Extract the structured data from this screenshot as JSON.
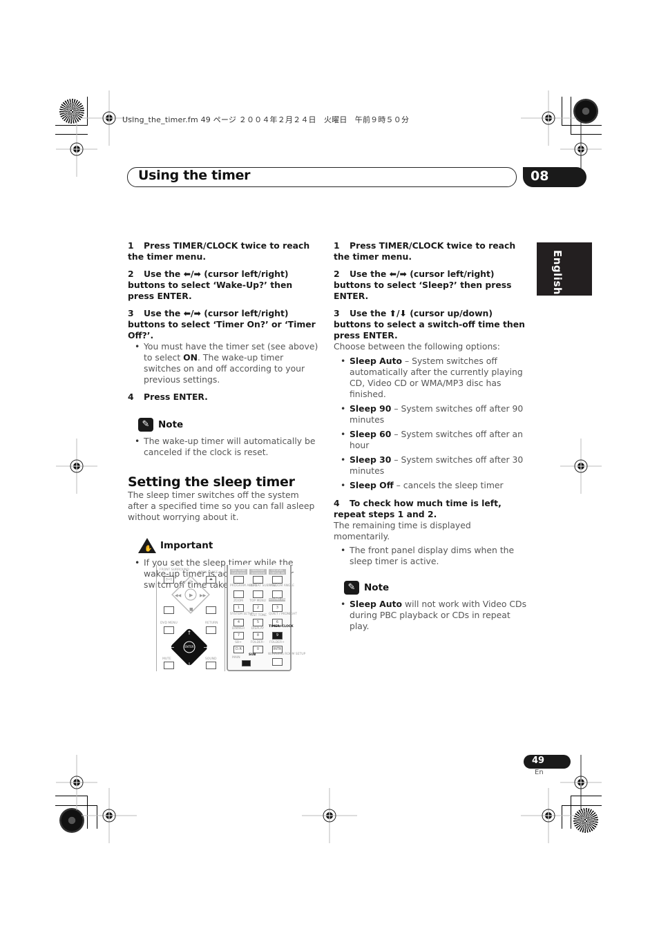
{
  "print_slug": "Using_the_timer.fm  49 ページ  ２００４年２月２４日　火曜日　午前９時５０分",
  "header": {
    "title": "Using the timer",
    "chapter": "08"
  },
  "language_tab": "English",
  "left_column": {
    "steps": [
      {
        "num": "1",
        "text": "Press TIMER/CLOCK twice to reach the timer menu."
      },
      {
        "num": "2",
        "text": "Use the ⬅/➡ (cursor left/right) buttons to select ‘Wake-Up?’ then press ENTER."
      },
      {
        "num": "3",
        "text": "Use the ⬅/➡ (cursor left/right) buttons to select ‘Timer On?’ or ‘Timer Off?’."
      }
    ],
    "step3_bullet_pre": "You must have the timer set (see above) to select ",
    "step3_bullet_bold": "ON",
    "step3_bullet_post": ". The wake-up timer switches on and off according to your previous settings.",
    "step4": {
      "num": "4",
      "text": "Press ENTER."
    },
    "note": {
      "label": "Note",
      "bullet": "The wake-up timer will automatically be canceled if the clock is reset."
    },
    "section": {
      "title": "Setting the sleep timer",
      "body": "The sleep timer switches off the system after a specified time so you can fall asleep without worrying about it."
    },
    "important": {
      "label": "Important",
      "bullet": "If you set the sleep timer while the wake-up timer is active, the earlier switch off time takes priority."
    }
  },
  "remote": {
    "front_surround": "FRONT SURROUND",
    "open_close": "OPEN CLOSE",
    "dvd_menu": "DVD MENU",
    "return": "RETURN",
    "mute": "MUTE",
    "sound": "SOUND",
    "enter": "ENTER",
    "top_row": [
      "DISC MODE SURROUND",
      "DIALOGUE ADVANCED",
      "CH LEVEL VIRTUAL SB"
    ],
    "row2": [
      "PROGRAM AUDIO",
      "REPEAT SUBTITLE",
      "RANDOM ANGLE"
    ],
    "row3_labels": [
      "ZOOM",
      "TOP MENU",
      "SOUND MENU"
    ],
    "row3_keys": [
      "1",
      "2",
      "3"
    ],
    "row4_labels": [
      "SYSTEM SETUP",
      "TEST TONE",
      "QUIET / MIDNIGHT"
    ],
    "row4_keys": [
      "4",
      "5",
      "6"
    ],
    "row5_labels": [
      "DIMMER",
      "DISPLAY",
      "TIMER/ CLOCK"
    ],
    "row5_keys": [
      "7",
      "8",
      "9"
    ],
    "row6_labels": [
      "SB+",
      "FOLDER–",
      "FOLDER+"
    ],
    "row6_keys": [
      "D.R",
      "0",
      "INTR"
    ],
    "main_sub": [
      "MAIN",
      "SUB"
    ],
    "wireless": "WIRELESS ROOM SETUP"
  },
  "right_column": {
    "steps": [
      {
        "num": "1",
        "text": "Press TIMER/CLOCK twice to reach the timer menu."
      },
      {
        "num": "2",
        "text": "Use the ⬅/➡ (cursor left/right) buttons to select ‘Sleep?’ then press ENTER."
      },
      {
        "num": "3",
        "text": "Use the ⬆/⬇ (cursor up/down) buttons to select a switch-off time then press ENTER."
      }
    ],
    "choose_text": "Choose between the following options:",
    "options": [
      {
        "name": "Sleep Auto",
        "desc": " – System switches off automatically after the currently playing CD, Video CD or WMA/MP3 disc has finished."
      },
      {
        "name": "Sleep 90",
        "desc": " – System switches off after 90 minutes"
      },
      {
        "name": "Sleep 60",
        "desc": " – System switches off after an hour"
      },
      {
        "name": "Sleep 30",
        "desc": " – System switches off after 30 minutes"
      },
      {
        "name": "Sleep Off",
        "desc": " – cancels the sleep timer"
      }
    ],
    "step4": {
      "num": "4",
      "text": "To check how much time is left, repeat steps 1 and 2."
    },
    "step4_body": "The remaining time is displayed momentarily.",
    "step4_bullet": "The front panel display dims when the sleep timer is active.",
    "note": {
      "label": "Note",
      "bullet_bold": "Sleep Auto",
      "bullet_rest": " will not work with Video CDs during PBC playback or CDs in repeat play."
    }
  },
  "footer": {
    "page_number": "49",
    "language": "En"
  }
}
